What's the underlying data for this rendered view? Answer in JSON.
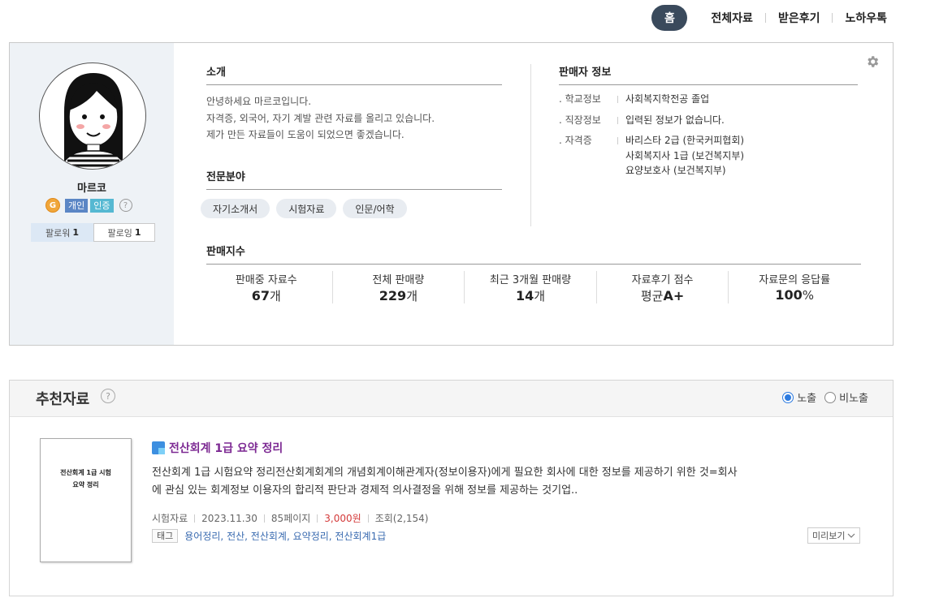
{
  "topnav": {
    "home": "홈",
    "items": [
      "전체자료",
      "받은후기",
      "노하우톡"
    ]
  },
  "profile": {
    "name": "마르코",
    "grade_badge": "G",
    "badge_personal": "개인",
    "badge_verified": "인증",
    "help": "?",
    "followers_label": "팔로워",
    "followers_count": "1",
    "following_label": "팔로잉",
    "following_count": "1"
  },
  "intro": {
    "title": "소개",
    "lines": [
      "안녕하세요 마르코입니다.",
      "자격증, 외국어, 자기 계발 관련 자료를 올리고 있습니다.",
      "제가 만든 자료들이 도움이 되었으면 좋겠습니다."
    ]
  },
  "expertise": {
    "title": "전문분야",
    "chips": [
      "자기소개서",
      "시험자료",
      "인문/어학"
    ]
  },
  "seller_info": {
    "title": "판매자 정보",
    "school_label": ". 학교정보",
    "school_value": "사회복지학전공 졸업",
    "job_label": ". 직장정보",
    "job_value": "입력된 정보가 없습니다.",
    "cert_label": ". 자격증",
    "cert_values": [
      "바리스타 2급 (한국커피협회)",
      "사회복지사 1급 (보건복지부)",
      "요양보호사 (보건복지부)"
    ]
  },
  "sales_index": {
    "title": "판매지수",
    "stats": [
      {
        "label": "판매중 자료수",
        "value": "67",
        "unit": "개",
        "prefix": ""
      },
      {
        "label": "전체 판매량",
        "value": "229",
        "unit": "개",
        "prefix": ""
      },
      {
        "label": "최근 3개월 판매량",
        "value": "14",
        "unit": "개",
        "prefix": ""
      },
      {
        "label": "자료후기 점수",
        "value": "A+",
        "unit": "",
        "prefix": "평균"
      },
      {
        "label": "자료문의 응답률",
        "value": "100",
        "unit": "%",
        "prefix": ""
      }
    ]
  },
  "recommend": {
    "title": "추천자료",
    "help": "?",
    "radio_show": "노출",
    "radio_hide": "비노출",
    "selected": "노출",
    "item": {
      "thumb_line1": "전산회계 1급 시험",
      "thumb_line2": "요약 정리",
      "title": "전산회계 1급 요약 정리",
      "desc_line1": "전산회계 1급 시험요약 정리전산회계회계의 개념회계이해관계자(정보이용자)에게 필요한 회사에 대한 정보를 제공하기 위한 것=회사",
      "desc_line2": "에 관심 있는 회계정보 이용자의 합리적 판단과 경제적 의사결정을 위해 정보를 제공하는 것기업..",
      "category": "시험자료",
      "date": "2023.11.30",
      "pages": "85페이지",
      "price": "3,000원",
      "views": "조회(2,154)",
      "tag_label": "태그",
      "tags": [
        "용어정리,",
        "전산,",
        "전산회계,",
        "요약정리,",
        "전산회계1급"
      ],
      "preview": "미리보기"
    }
  },
  "colors": {
    "nav_home_bg": "#3a4a5c",
    "title_purple": "#7d2a93",
    "price_red": "#d43a3a",
    "tag_blue": "#3a6bb0",
    "radio_blue": "#2d7be0"
  }
}
